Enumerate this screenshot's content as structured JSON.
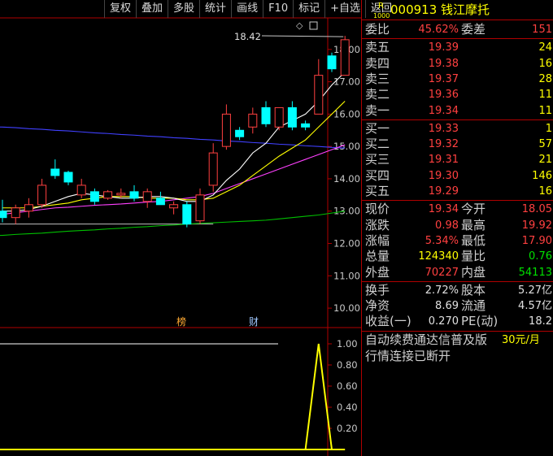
{
  "toolbar": {
    "buttons": [
      "复权",
      "叠加",
      "多股",
      "统计",
      "画线",
      "F10",
      "标记",
      "+自选",
      "返回"
    ]
  },
  "stock": {
    "badge_top": "R",
    "badge_bottom": "1000",
    "code_name": "000913 钱江摩托"
  },
  "chart": {
    "price_ticks": [
      "18.00",
      "17.00",
      "16.00",
      "15.00",
      "14.00",
      "13.00",
      "12.00",
      "11.00",
      "10.00"
    ],
    "max_label": "18.42",
    "event_markers": [
      "榜",
      "财"
    ],
    "indicator_ticks": [
      "1.00",
      "0.80",
      "0.60",
      "0.40",
      "0.20"
    ],
    "colors": {
      "up": "#ff4040",
      "down": "#00ffff",
      "ma5": "#ffffff",
      "ma10": "#ffff00",
      "ma20": "#ff40ff",
      "ma60": "#00c000",
      "ma120": "#4040ff"
    }
  },
  "chart_data": {
    "type": "candlestick",
    "ylim": [
      9.6,
      18.9
    ],
    "candles": [
      {
        "o": 13.0,
        "h": 13.35,
        "l": 12.65,
        "c": 12.8
      },
      {
        "o": 12.8,
        "h": 13.2,
        "l": 12.6,
        "c": 13.1
      },
      {
        "o": 13.0,
        "h": 13.4,
        "l": 12.8,
        "c": 13.2
      },
      {
        "o": 13.2,
        "h": 14.0,
        "l": 13.1,
        "c": 13.8
      },
      {
        "o": 14.3,
        "h": 14.6,
        "l": 14.0,
        "c": 14.1
      },
      {
        "o": 14.2,
        "h": 14.25,
        "l": 13.8,
        "c": 13.9
      },
      {
        "o": 13.5,
        "h": 14.0,
        "l": 13.4,
        "c": 13.8
      },
      {
        "o": 13.6,
        "h": 13.7,
        "l": 13.2,
        "c": 13.3
      },
      {
        "o": 13.4,
        "h": 13.65,
        "l": 13.35,
        "c": 13.6
      },
      {
        "o": 13.5,
        "h": 13.7,
        "l": 13.4,
        "c": 13.55
      },
      {
        "o": 13.6,
        "h": 13.8,
        "l": 13.3,
        "c": 13.4
      },
      {
        "o": 13.3,
        "h": 13.7,
        "l": 13.1,
        "c": 13.6
      },
      {
        "o": 13.4,
        "h": 13.6,
        "l": 13.3,
        "c": 13.2
      },
      {
        "o": 13.1,
        "h": 13.3,
        "l": 12.9,
        "c": 13.2
      },
      {
        "o": 13.2,
        "h": 13.3,
        "l": 12.5,
        "c": 12.6
      },
      {
        "o": 12.7,
        "h": 13.7,
        "l": 12.6,
        "c": 13.5
      },
      {
        "o": 13.8,
        "h": 15.1,
        "l": 13.6,
        "c": 14.8
      },
      {
        "o": 15.0,
        "h": 16.3,
        "l": 14.9,
        "c": 16.0
      },
      {
        "o": 15.5,
        "h": 15.6,
        "l": 15.2,
        "c": 15.3
      },
      {
        "o": 15.6,
        "h": 16.2,
        "l": 15.4,
        "c": 16.0
      },
      {
        "o": 16.2,
        "h": 16.4,
        "l": 15.6,
        "c": 15.7
      },
      {
        "o": 15.6,
        "h": 16.1,
        "l": 15.5,
        "c": 16.2
      },
      {
        "o": 16.2,
        "h": 16.4,
        "l": 15.5,
        "c": 15.6
      },
      {
        "o": 15.7,
        "h": 15.8,
        "l": 15.5,
        "c": 15.6
      },
      {
        "o": 16.0,
        "h": 17.7,
        "l": 16.0,
        "c": 17.2
      },
      {
        "o": 17.8,
        "h": 17.9,
        "l": 17.3,
        "c": 17.4
      },
      {
        "o": 17.2,
        "h": 18.42,
        "l": 17.2,
        "c": 18.3
      }
    ],
    "ma5": [
      13.0,
      13.0,
      13.05,
      13.15,
      13.3,
      13.45,
      13.55,
      13.5,
      13.45,
      13.4,
      13.4,
      13.45,
      13.45,
      13.4,
      13.3,
      13.3,
      13.5,
      13.95,
      14.3,
      14.8,
      15.1,
      15.6,
      15.8,
      16.0,
      16.4,
      16.9,
      17.3
    ],
    "ma10": [
      13.1,
      13.1,
      13.1,
      13.15,
      13.2,
      13.25,
      13.35,
      13.4,
      13.45,
      13.45,
      13.45,
      13.4,
      13.4,
      13.4,
      13.35,
      13.35,
      13.4,
      13.6,
      13.8,
      14.1,
      14.4,
      14.7,
      14.95,
      15.2,
      15.6,
      16.0,
      16.4
    ],
    "ma20": [
      12.9,
      12.95,
      13.0,
      13.05,
      13.1,
      13.12,
      13.15,
      13.18,
      13.2,
      13.22,
      13.25,
      13.28,
      13.3,
      13.35,
      13.4,
      13.45,
      13.55,
      13.7,
      13.85,
      14.0,
      14.15,
      14.3,
      14.45,
      14.6,
      14.75,
      14.9,
      15.05
    ],
    "ma60": [
      12.25,
      12.28,
      12.3,
      12.32,
      12.35,
      12.38,
      12.4,
      12.42,
      12.45,
      12.47,
      12.5,
      12.52,
      12.55,
      12.57,
      12.6,
      12.62,
      12.64,
      12.66,
      12.68,
      12.7,
      12.72,
      12.76,
      12.8,
      12.84,
      12.88,
      12.94,
      13.0
    ],
    "ma120": [
      15.6,
      15.58,
      15.55,
      15.53,
      15.5,
      15.48,
      15.45,
      15.42,
      15.4,
      15.37,
      15.35,
      15.32,
      15.3,
      15.27,
      15.25,
      15.22,
      15.2,
      15.17,
      15.15,
      15.12,
      15.1,
      15.07,
      15.05,
      15.02,
      15.0,
      14.97,
      14.95
    ],
    "flat_line": 12.6,
    "indicator": [
      0,
      0,
      0,
      0,
      0,
      0,
      0,
      0,
      0,
      0,
      0,
      0,
      0,
      0,
      0,
      0,
      0,
      0,
      0,
      0,
      0,
      0,
      0,
      1,
      0,
      0
    ],
    "indicator_ylim": [
      0,
      1.1
    ]
  },
  "panel": {
    "commission_ratio": {
      "label": "委比",
      "value": "45.62%",
      "label2": "委差",
      "value2": "151"
    },
    "sells": [
      {
        "label": "卖五",
        "price": "19.39",
        "vol": "24"
      },
      {
        "label": "卖四",
        "price": "19.38",
        "vol": "16"
      },
      {
        "label": "卖三",
        "price": "19.37",
        "vol": "28"
      },
      {
        "label": "卖二",
        "price": "19.36",
        "vol": "11"
      },
      {
        "label": "卖一",
        "price": "19.34",
        "vol": "11"
      }
    ],
    "buys": [
      {
        "label": "买一",
        "price": "19.33",
        "vol": "1"
      },
      {
        "label": "买二",
        "price": "19.32",
        "vol": "57"
      },
      {
        "label": "买三",
        "price": "19.31",
        "vol": "21"
      },
      {
        "label": "买四",
        "price": "19.30",
        "vol": "146"
      },
      {
        "label": "买五",
        "price": "19.29",
        "vol": "16"
      }
    ],
    "quote": [
      {
        "l1": "现价",
        "v1": "19.34",
        "c1": "red",
        "l2": "今开",
        "v2": "18.05",
        "c2": "red"
      },
      {
        "l1": "涨跌",
        "v1": "0.98",
        "c1": "red",
        "l2": "最高",
        "v2": "19.92",
        "c2": "red"
      },
      {
        "l1": "涨幅",
        "v1": "5.34%",
        "c1": "red",
        "l2": "最低",
        "v2": "17.90",
        "c2": "red"
      },
      {
        "l1": "总量",
        "v1": "124340",
        "c1": "yellow",
        "l2": "量比",
        "v2": "0.76",
        "c2": "green"
      },
      {
        "l1": "外盘",
        "v1": "70227",
        "c1": "red",
        "l2": "内盘",
        "v2": "54113",
        "c2": "green"
      }
    ],
    "fundamentals": [
      {
        "l1": "换手",
        "v1": "2.72%",
        "l2": "股本",
        "v2": "5.27亿"
      },
      {
        "l1": "净资",
        "v1": "8.69",
        "l2": "流通",
        "v2": "4.57亿"
      },
      {
        "l1": "收益(一)",
        "v1": "0.270",
        "l2": "PE(动)",
        "v2": "18.2"
      }
    ],
    "ad_text": "自动续费通达信普及版",
    "ad_price": "30元/月",
    "status": "行情连接已断开"
  }
}
